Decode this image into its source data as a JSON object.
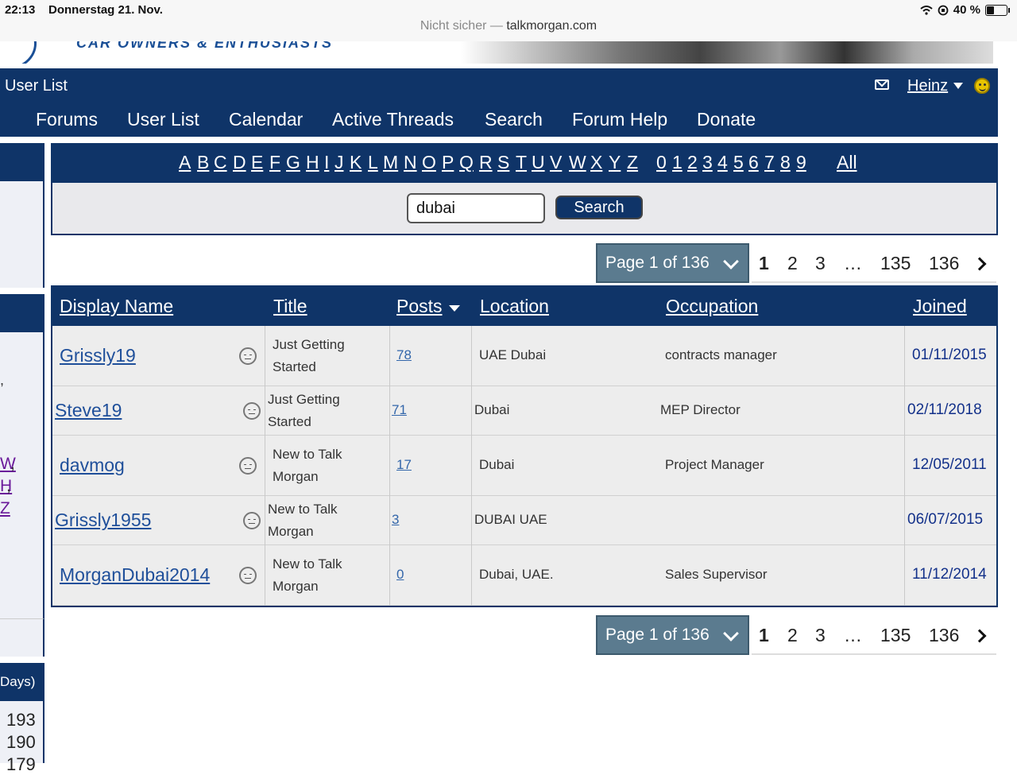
{
  "statusbar": {
    "time": "22:13",
    "date": "Donnerstag 21. Nov.",
    "not_secure": "Nicht sicher — ",
    "domain": "talkmorgan.com",
    "battery": "40 %"
  },
  "banner": {
    "logo_text": "CAR OWNERS & ENTHUSIASTS"
  },
  "nav": {
    "title": "User List",
    "user": "Heinz",
    "links": [
      "Forums",
      "User List",
      "Calendar",
      "Active Threads",
      "Search",
      "Forum Help",
      "Donate"
    ]
  },
  "alphabet": [
    "A",
    "B",
    "C",
    "D",
    "E",
    "F",
    "G",
    "H",
    "I",
    "J",
    "K",
    "L",
    "M",
    "N",
    "O",
    "P",
    "Q",
    "R",
    "S",
    "T",
    "U",
    "V",
    "W",
    "X",
    "Y",
    "Z"
  ],
  "digits": [
    "0",
    "1",
    "2",
    "3",
    "4",
    "5",
    "6",
    "7",
    "8",
    "9"
  ],
  "all_label": "All",
  "search": {
    "value": "dubai",
    "button": "Search"
  },
  "pager": {
    "label": "Page 1 of 136",
    "pages": [
      "1",
      "2",
      "3",
      "…",
      "135",
      "136"
    ],
    "current": "1"
  },
  "table": {
    "headers": {
      "name": "Display Name",
      "title": "Title",
      "posts": "Posts",
      "location": "Location",
      "occupation": "Occupation",
      "joined": "Joined"
    },
    "rows": [
      {
        "name": "Grissly19",
        "title1": "Just Getting",
        "title2": "Started",
        "posts": "78",
        "location": "UAE Dubai",
        "occupation": "contracts manager",
        "joined": "01/11/2015"
      },
      {
        "name": "Steve19",
        "title1": "Just Getting",
        "title2": "Started",
        "posts": "71",
        "location": "Dubai",
        "occupation": "MEP Director",
        "joined": "02/11/2018"
      },
      {
        "name": "davmog",
        "title1": "New to Talk",
        "title2": "Morgan",
        "posts": "17",
        "location": "Dubai",
        "occupation": "Project Manager",
        "joined": "12/05/2011"
      },
      {
        "name": "Grissly1955",
        "title1": "New to Talk",
        "title2": "Morgan",
        "posts": "3",
        "location": "DUBAI UAE",
        "occupation": "",
        "joined": "06/07/2015"
      },
      {
        "name": "MorganDubai2014",
        "title1": "New to Talk",
        "title2": "Morgan",
        "posts": "0",
        "location": "Dubai, UAE.",
        "occupation": "Sales Supervisor",
        "joined": "11/12/2014"
      }
    ]
  },
  "sidebar": {
    "comma1": ",",
    "letter_w": "W",
    "letter_h": "H",
    "letter_z": "Z",
    "days_label": "Days)",
    "counts": [
      "193",
      "190",
      "179"
    ]
  },
  "colors": {
    "nav_bg": "#0f3468",
    "pager_bg": "#5b7b8f",
    "link": "#1f4f9a"
  }
}
